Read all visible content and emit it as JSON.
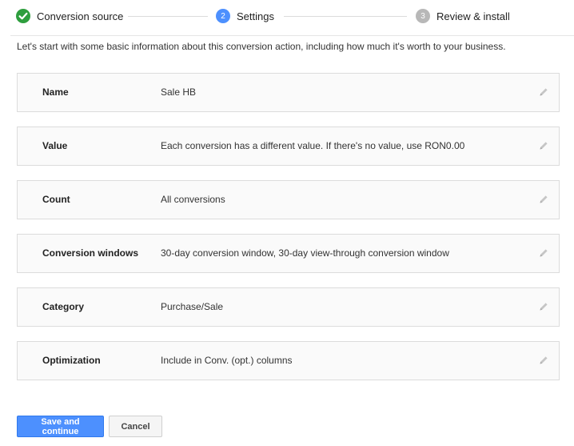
{
  "stepper": {
    "steps": [
      {
        "label": "Conversion source",
        "state": "done",
        "number": ""
      },
      {
        "label": "Settings",
        "state": "active",
        "number": "2"
      },
      {
        "label": "Review & install",
        "state": "pending",
        "number": "3"
      }
    ]
  },
  "intro": "Let's start with some basic information about this conversion action, including how much it's worth to your business.",
  "settings": [
    {
      "label": "Name",
      "value": "Sale HB"
    },
    {
      "label": "Value",
      "value": "Each conversion has a different value. If there's no value, use RON0.00"
    },
    {
      "label": "Count",
      "value": "All conversions"
    },
    {
      "label": "Conversion windows",
      "value": "30-day conversion window, 30-day view-through conversion window"
    },
    {
      "label": "Category",
      "value": "Purchase/Sale"
    },
    {
      "label": "Optimization",
      "value": "Include in Conv. (opt.) columns"
    }
  ],
  "actions": {
    "save_label": "Save and continue",
    "cancel_label": "Cancel"
  },
  "colors": {
    "accent": "#4d90fe",
    "done": "#2e9e3e",
    "pending": "#b8b8b8"
  },
  "icons": {
    "done_step": "check-circle-icon",
    "edit": "pencil-icon"
  }
}
